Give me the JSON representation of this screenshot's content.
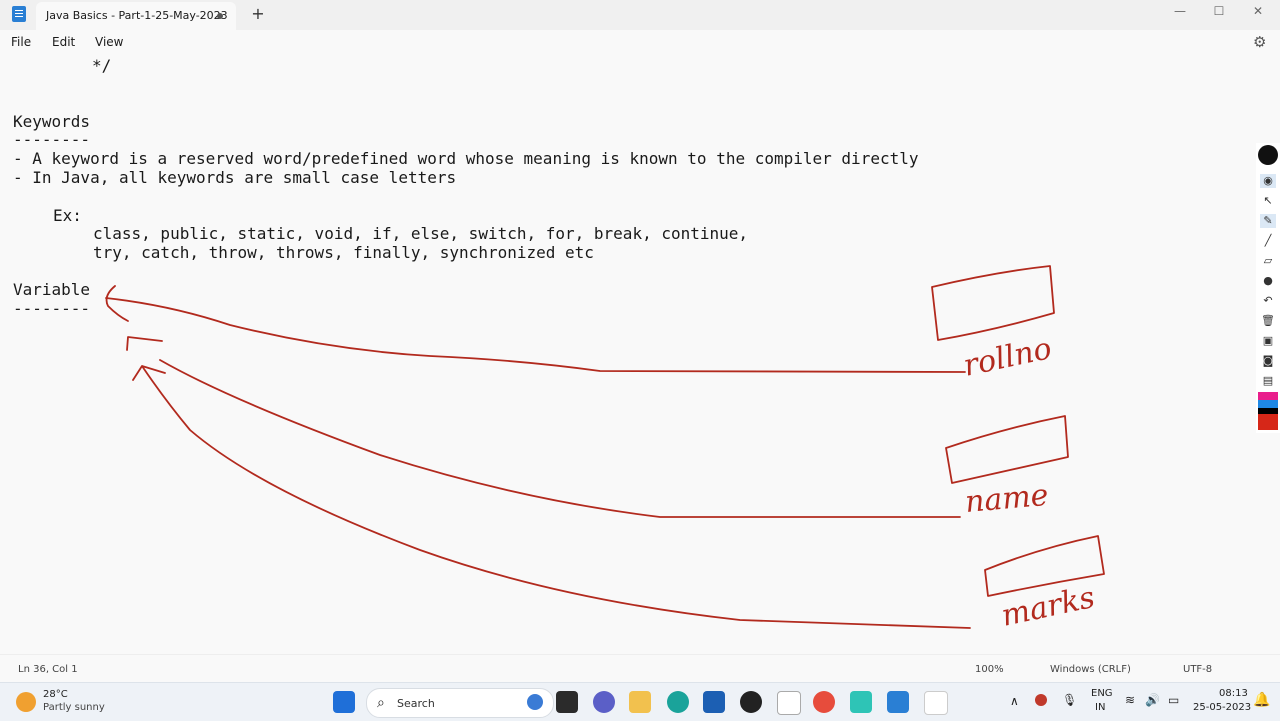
{
  "window": {
    "tab_title": "Java Basics - Part-1-25-May-2023",
    "new_tab_icon": "+",
    "minimize_icon": "—",
    "maximize_icon": "☐",
    "close_icon": "✕"
  },
  "menu": {
    "file": "File",
    "edit": "Edit",
    "view": "View",
    "settings_icon": "⚙"
  },
  "editor": {
    "lines": [
      "*/",
      "Keywords",
      "--------",
      "- A keyword is a reserved word/predefined word whose meaning is known to the compiler directly",
      "- In Java, all keywords are small case letters",
      "Ex:",
      "class, public, static, void, if, else, switch, for, break, continue,",
      "try, catch, throw, throws, finally, synchronized etc",
      "Variable",
      "--------"
    ],
    "annotations": {
      "box1_label": "rollno",
      "box2_label": "name",
      "box3_label": "marks",
      "ink_color": "#b22a1e"
    }
  },
  "pen_toolbar": {
    "tools": [
      "eye-icon",
      "pointer-icon",
      "pen-icon",
      "line-icon",
      "eraser-icon",
      "dot-icon",
      "undo-icon",
      "trash-icon",
      "screen-capture-icon",
      "camera-icon",
      "clipboard-icon"
    ],
    "colors": [
      "#e91e8c",
      "#1e88e5",
      "#000000",
      "#d62718"
    ]
  },
  "status": {
    "position": "Ln 36, Col 1",
    "zoom": "100%",
    "line_ending": "Windows (CRLF)",
    "encoding": "UTF-8"
  },
  "taskbar": {
    "temperature": "28°C",
    "weather": "Partly sunny",
    "search_label": "Search",
    "language_1": "ENG",
    "language_2": "IN",
    "time": "08:13",
    "date": "25-05-2023"
  }
}
